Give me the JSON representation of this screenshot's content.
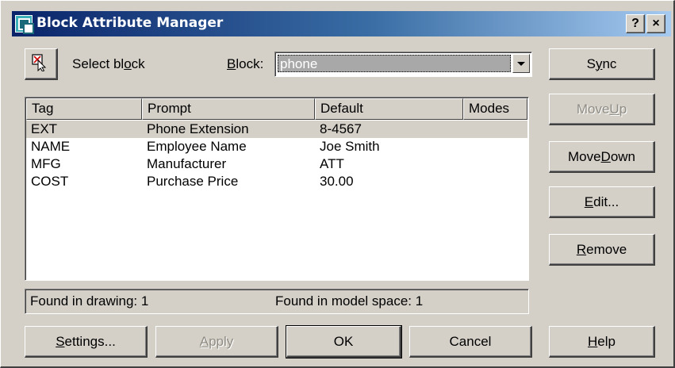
{
  "window": {
    "title": "Block Attribute Manager",
    "help_button": "?",
    "close_button": "×"
  },
  "select_block": {
    "label": "Select block"
  },
  "block": {
    "label": "Block:",
    "value": "phone"
  },
  "table": {
    "columns": [
      "Tag",
      "Prompt",
      "Default",
      "Modes"
    ],
    "rows": [
      {
        "tag": "EXT",
        "prompt": "Phone Extension",
        "default": "8-4567",
        "modes": "",
        "selected": true
      },
      {
        "tag": "NAME",
        "prompt": "Employee Name",
        "default": "Joe Smith",
        "modes": "",
        "selected": false
      },
      {
        "tag": "MFG",
        "prompt": "Manufacturer",
        "default": "ATT",
        "modes": "",
        "selected": false
      },
      {
        "tag": "COST",
        "prompt": "Purchase Price",
        "default": "30.00",
        "modes": "",
        "selected": false
      }
    ]
  },
  "status": {
    "found_in_drawing": "Found in drawing: 1",
    "found_in_model_space": "Found in model space: 1"
  },
  "side_buttons": {
    "sync": "Sync",
    "move_up": "Move Up",
    "move_down": "Move Down",
    "edit": "Edit...",
    "remove": "Remove"
  },
  "bottom_buttons": {
    "settings": "Settings...",
    "apply": "Apply",
    "ok": "OK",
    "cancel": "Cancel",
    "help": "Help"
  },
  "colors": {
    "dialog_face": "#d4d0c8",
    "titlebar_start": "#0a246a",
    "titlebar_end": "#a6caf0",
    "disabled_text": "#8f8c84"
  }
}
